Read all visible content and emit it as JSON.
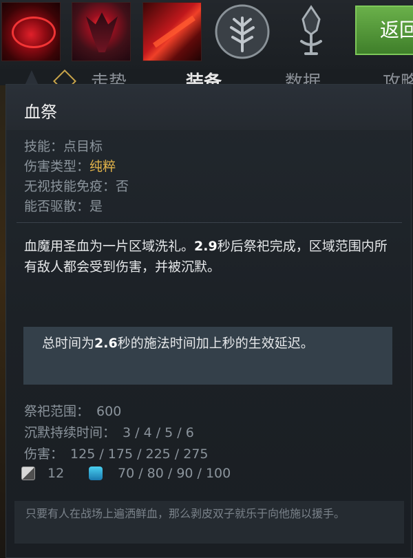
{
  "topbar": {
    "abilities": [
      "blood-rite",
      "bloodrage-portrait",
      "rupture"
    ],
    "talents": [
      "talent-tree-icon",
      "aghanim-scepter-icon"
    ],
    "return_label": "返回"
  },
  "tabs": [
    {
      "label": "走势",
      "active": false
    },
    {
      "label": "装备",
      "active": true
    },
    {
      "label": "数据",
      "active": false
    },
    {
      "label": "攻略",
      "active": false
    }
  ],
  "tooltip": {
    "title": "血祭",
    "attrs": {
      "ability_label": "技能：点目标",
      "damage_type_label": "伤害类型：",
      "damage_type_value": "纯粹",
      "spell_immunity": "无视技能免疫：否",
      "dispel": "能否驱散：是"
    },
    "description": {
      "part1": "血魔用圣血为一片区域洗礼。",
      "bold": "2.9",
      "part2": "秒后祭祀完成，区域范围内所有敌人都会受到伤害，并被沉默。"
    },
    "note": {
      "part1": "总时间为",
      "bold": "2.6",
      "part2": "秒的施法时间加上秒的生效延迟。"
    },
    "stats": [
      {
        "label": "祭祀范围：",
        "value": "600"
      },
      {
        "label": "沉默持续时间：",
        "value": "3 / 4 / 5 / 6"
      },
      {
        "label": "伤害：",
        "value": "125 / 175 / 225 / 275"
      }
    ],
    "cooldown": "12",
    "mana_cost": "70 / 80 / 90 / 100",
    "lore": "只要有人在战场上遍洒鲜血，那么剥皮双子就乐于向他施以援手。"
  },
  "colors": {
    "accent_gold": "#e0b24a",
    "return_button": "#5a9e3c",
    "mana": "#2aa8e0"
  }
}
